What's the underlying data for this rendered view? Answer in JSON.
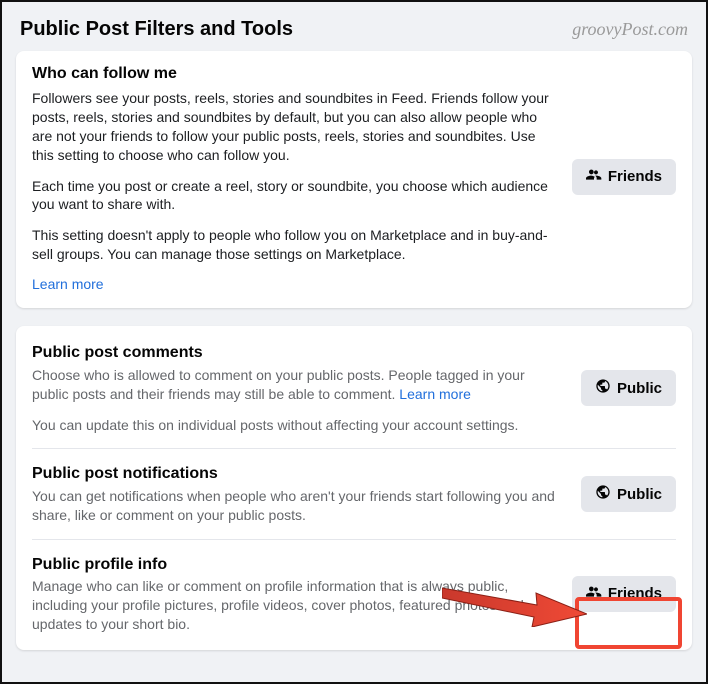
{
  "watermark": "groovyPost.com",
  "page_title": "Public Post Filters and Tools",
  "card1": {
    "title": "Who can follow me",
    "p1": "Followers see your posts, reels, stories and soundbites in Feed. Friends follow your posts, reels, stories and soundbites by default, but you can also allow people who are not your friends to follow your public posts, reels, stories and soundbites. Use this setting to choose who can follow you.",
    "p2": "Each time you post or create a reel, story or soundbite, you choose which audience you want to share with.",
    "p3": "This setting doesn't apply to people who follow you on Marketplace and in buy-and-sell groups. You can manage those settings on Marketplace.",
    "learn_more": "Learn more",
    "button": "Friends"
  },
  "card2": {
    "s1": {
      "title": "Public post comments",
      "p1a": "Choose who is allowed to comment on your public posts. People tagged in your public posts and their friends may still be able to comment. ",
      "learn_more": "Learn more",
      "p2": "You can update this on individual posts without affecting your account settings.",
      "button": "Public"
    },
    "s2": {
      "title": "Public post notifications",
      "p1": "You can get notifications when people who aren't your friends start following you and share, like or comment on your public posts.",
      "button": "Public"
    },
    "s3": {
      "title": "Public profile info",
      "p1": "Manage who can like or comment on profile information that is always public, including your profile pictures, profile videos, cover photos, featured photos and updates to your short bio.",
      "button": "Friends"
    }
  }
}
